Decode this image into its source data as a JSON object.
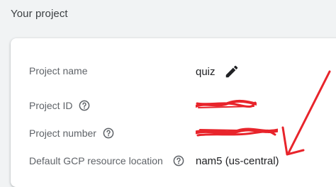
{
  "section": {
    "title": "Your project"
  },
  "rows": [
    {
      "label": "Project name",
      "value": "quiz"
    },
    {
      "label": "Project ID",
      "value": ""
    },
    {
      "label": "Project number",
      "value": ""
    },
    {
      "label": "Default GCP resource location",
      "value": "nam5 (us-central)"
    }
  ],
  "icons": {
    "edit": "edit-icon",
    "help": "help-circle-icon"
  },
  "colors": {
    "label": "#5f6368",
    "value": "#202124",
    "redaction": "#e8242b",
    "annotation": "#e8242b"
  }
}
